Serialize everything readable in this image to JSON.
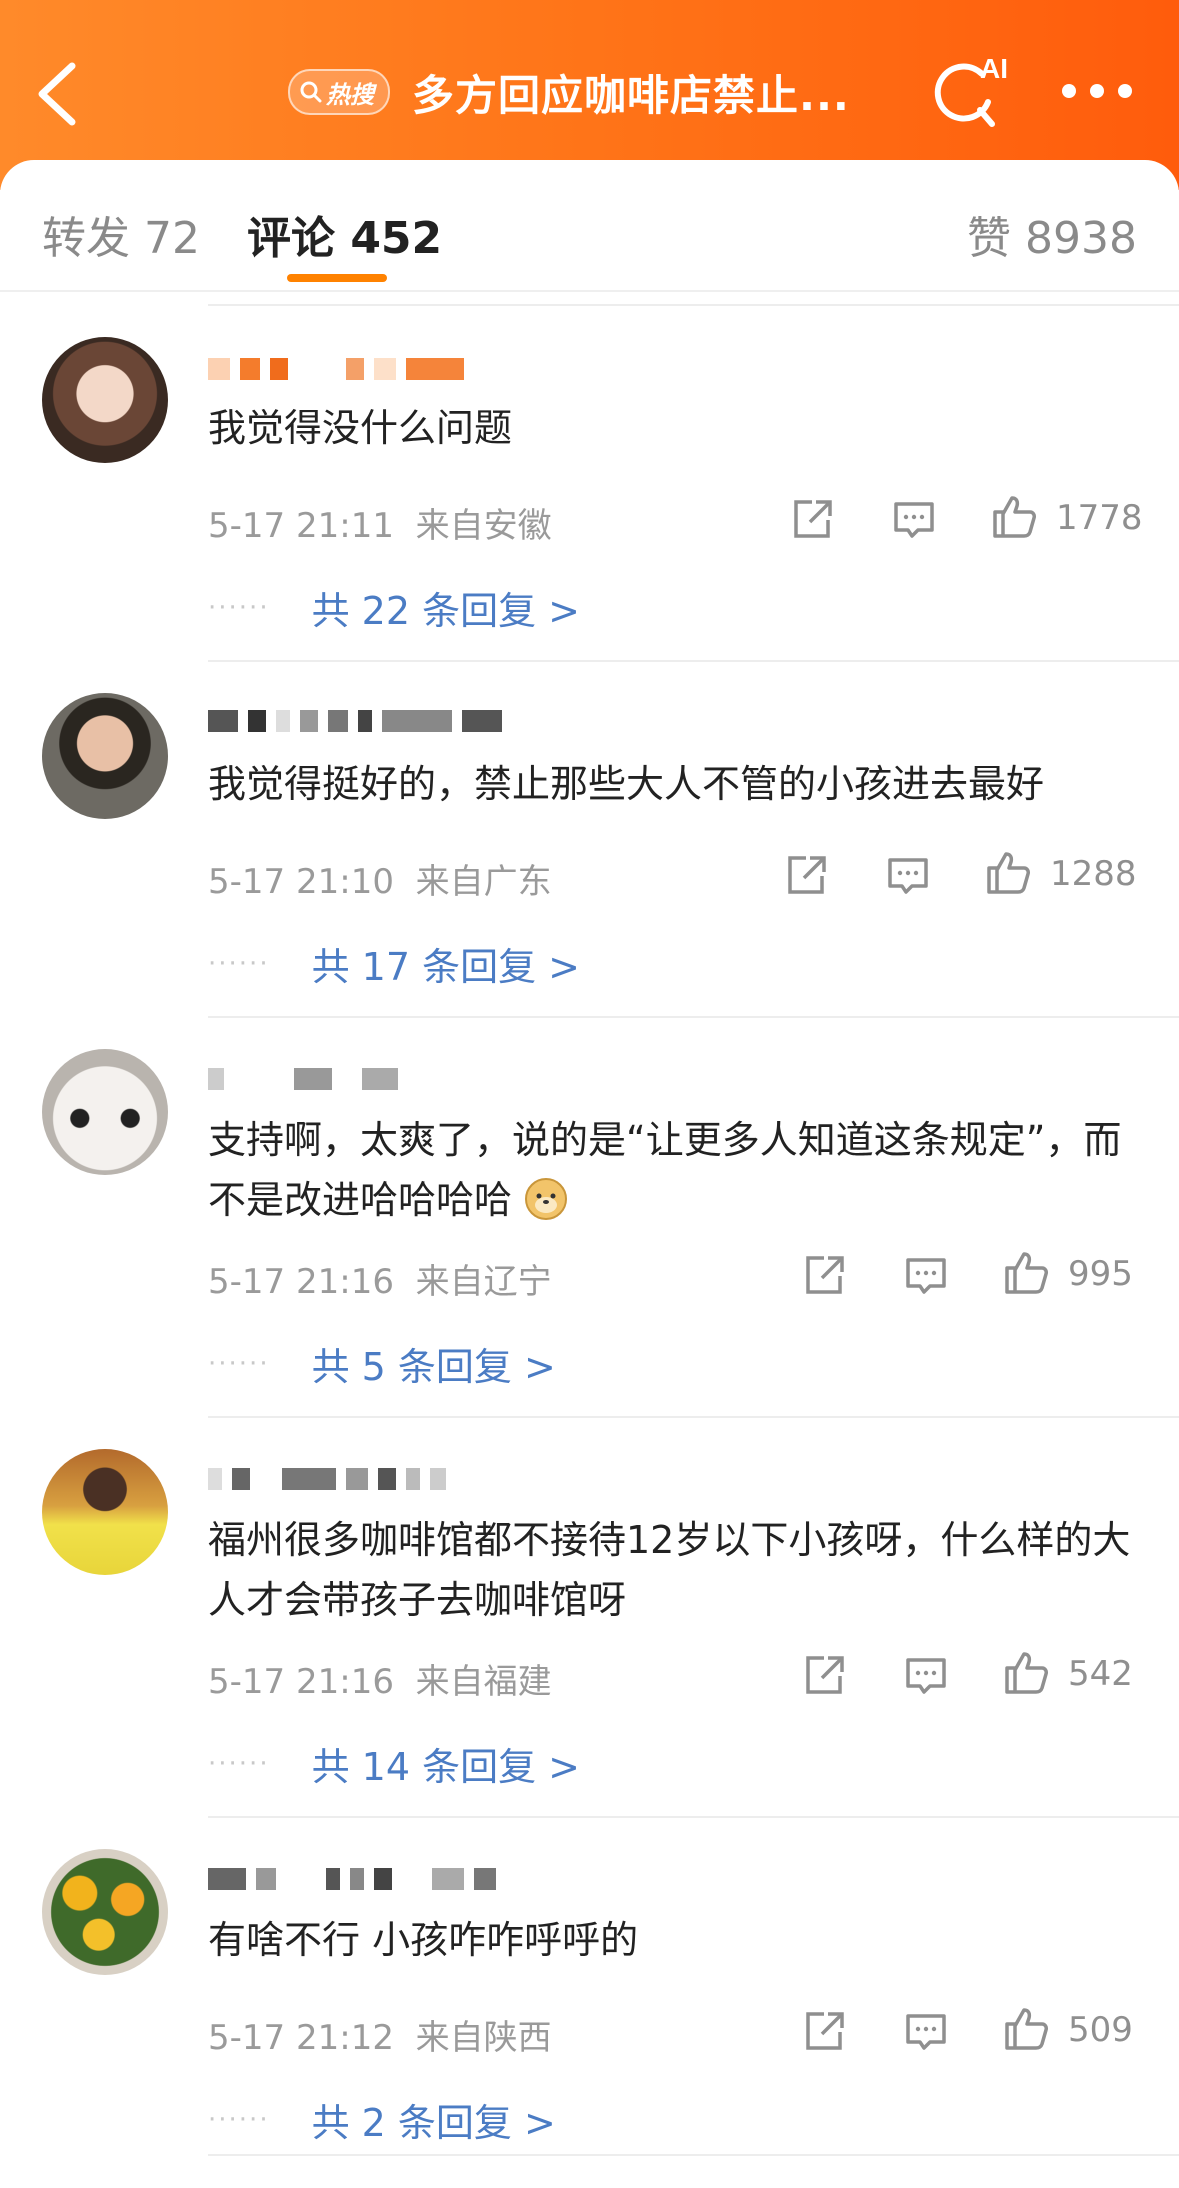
{
  "header": {
    "hot_badge": "热搜",
    "title": "多方回应咖啡店禁止...",
    "ai_label": "AI"
  },
  "tabs": [
    {
      "label": "转发 72"
    },
    {
      "label": "评论 452"
    },
    {
      "label": "赞 8938"
    }
  ],
  "colors": {
    "accent": "#ff7418",
    "link": "#4b7cc4",
    "underline": "#ff8200"
  },
  "icons": [
    "back-icon",
    "search-icon",
    "ai-search-icon",
    "more-icon",
    "share-icon",
    "comment-icon",
    "like-icon",
    "doge-emoji-icon"
  ],
  "comments": [
    {
      "text": "我觉得没什么问题",
      "time": "5-17 21:11",
      "location": "来自安徽",
      "likes": "1778",
      "replies": "共 22 条回复 >"
    },
    {
      "text": "我觉得挺好的，禁止那些大人不管的小孩进去最好",
      "time": "5-17 21:10",
      "location": "来自广东",
      "likes": "1288",
      "replies": "共 17 条回复 >"
    },
    {
      "text": "支持啊，太爽了，说的是“让更多人知道这条规定”，而不是改进哈哈哈哈",
      "time": "5-17 21:16",
      "location": "来自辽宁",
      "likes": "995",
      "replies": "共 5 条回复 >"
    },
    {
      "text": "福州很多咖啡馆都不接待12岁以下小孩呀，什么样的大人才会带孩子去咖啡馆呀",
      "time": "5-17 21:16",
      "location": "来自福建",
      "likes": "542",
      "replies": "共 14 条回复 >"
    },
    {
      "text": "有啥不行 小孩咋咋呼呼的",
      "time": "5-17 21:12",
      "location": "来自陕西",
      "likes": "509",
      "replies": "共 2 条回复 >"
    }
  ]
}
